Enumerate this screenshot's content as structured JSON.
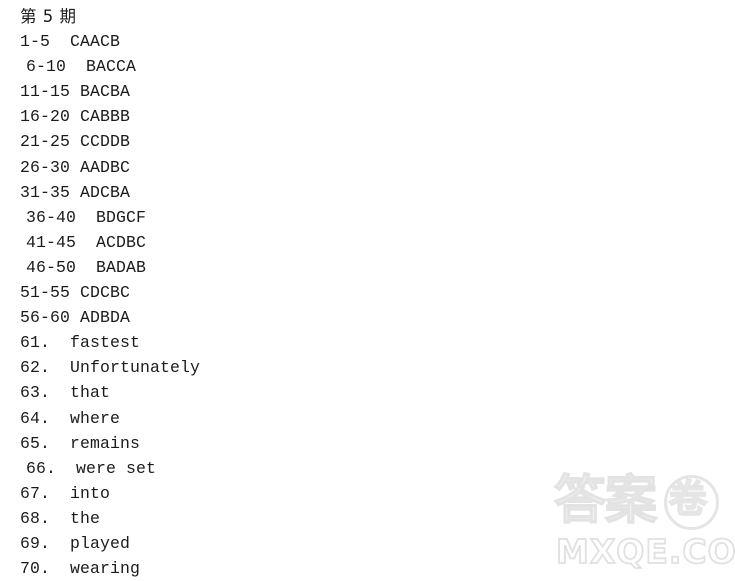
{
  "document": {
    "title": "第 5 期",
    "background_color": "#ffffff",
    "text_color": "#1b1b1b",
    "lines": [
      {
        "text": "1-5  CAACB",
        "indented": false
      },
      {
        "text": "6-10  BACCA",
        "indented": true
      },
      {
        "text": "11-15 BACBA",
        "indented": false
      },
      {
        "text": "16-20 CABBB",
        "indented": false
      },
      {
        "text": "21-25 CCDDB",
        "indented": false
      },
      {
        "text": "26-30 AADBC",
        "indented": false
      },
      {
        "text": "31-35 ADCBA",
        "indented": false
      },
      {
        "text": "36-40  BDGCF",
        "indented": true
      },
      {
        "text": "41-45  ACDBC",
        "indented": true
      },
      {
        "text": "46-50  BADAB",
        "indented": true
      },
      {
        "text": "51-55 CDCBC",
        "indented": false
      },
      {
        "text": "56-60 ADBDA",
        "indented": false
      },
      {
        "text": "61.  fastest",
        "indented": false
      },
      {
        "text": "62.  Unfortunately",
        "indented": false
      },
      {
        "text": "63.  that",
        "indented": false
      },
      {
        "text": "64.  where",
        "indented": false
      },
      {
        "text": "65.  remains",
        "indented": false
      },
      {
        "text": "66.  were set",
        "indented": true
      },
      {
        "text": "67.  into",
        "indented": false
      },
      {
        "text": "68.  the",
        "indented": false
      },
      {
        "text": "69.  played",
        "indented": false
      },
      {
        "text": "70.  wearing",
        "indented": false
      }
    ]
  },
  "watermark": {
    "cjk_text": "答案",
    "circled_char": "卷",
    "domain": "MXQE.COM",
    "color": "#e3e3e3"
  }
}
